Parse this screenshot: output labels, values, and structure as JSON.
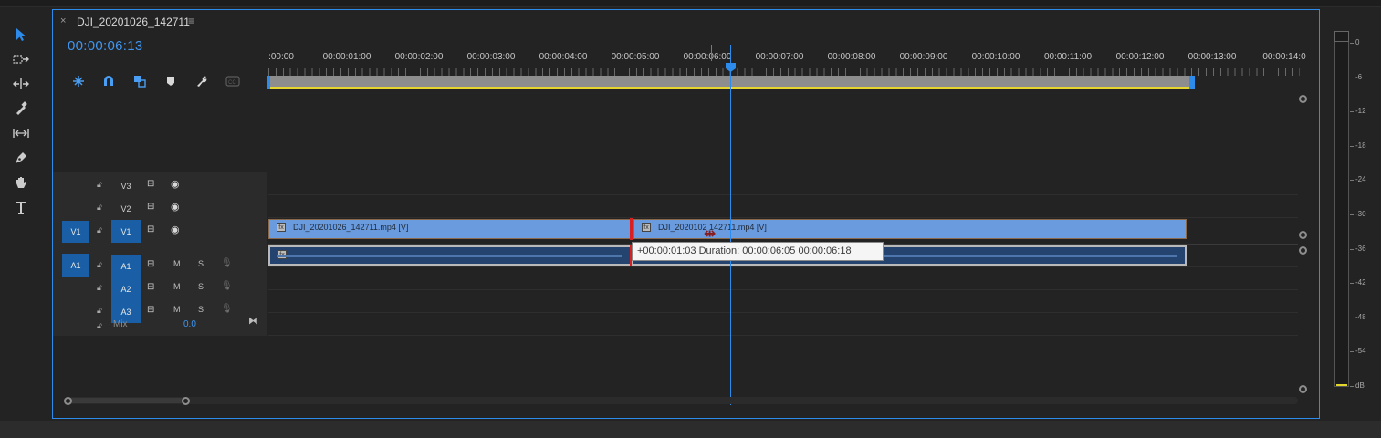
{
  "sequence": {
    "tab_close": "×",
    "tab_title": "DJI_20201026_142711",
    "tab_menu": "≡",
    "timecode": "00:00:06:13"
  },
  "tools": [
    "selection-tool",
    "track-select-tool",
    "ripple-edit-tool",
    "razor-tool",
    "slip-tool",
    "pen-tool",
    "hand-tool",
    "type-tool"
  ],
  "ruler_labels": [
    ":00:00",
    "00:00:01:00",
    "00:00:02:00",
    "00:00:03:00",
    "00:00:04:00",
    "00:00:05:00",
    "00:00:06:00",
    "00:00:07:00",
    "00:00:08:00",
    "00:00:09:00",
    "00:00:10:00",
    "00:00:11:00",
    "00:00:12:00",
    "00:00:13:00",
    "00:00:14:0"
  ],
  "tracks": {
    "video": [
      {
        "name": "V3",
        "patch": ""
      },
      {
        "name": "V2",
        "patch": ""
      },
      {
        "name": "V1",
        "patch": "V1"
      }
    ],
    "audio": [
      {
        "name": "A1",
        "patch": "A1",
        "mute": "M",
        "solo": "S"
      },
      {
        "name": "A2",
        "patch": "",
        "mute": "M",
        "solo": "S"
      },
      {
        "name": "A3",
        "patch": "",
        "mute": "M",
        "solo": "S"
      }
    ],
    "mix_label": "Mix",
    "mix_value": "0.0"
  },
  "clips": {
    "v1_clip_1": "DJI_20201026_142711.mp4 [V]",
    "v1_clip_2": "DJI_2020102   142711.mp4 [V]"
  },
  "tooltip": "+00:00:01:03 Duration: 00:00:06:05 00:00:06:18",
  "meter": {
    "labels": [
      "0",
      "-6",
      "-12",
      "-18",
      "-24",
      "-30",
      "-36",
      "-42",
      "-48",
      "-54",
      "dB"
    ]
  },
  "colors": {
    "accent": "#2d8ceb",
    "video_clip": "#6a9bde",
    "audio_clip": "#24436f",
    "edit_marker": "#d91f1f",
    "work_area": "#e6d52c"
  }
}
